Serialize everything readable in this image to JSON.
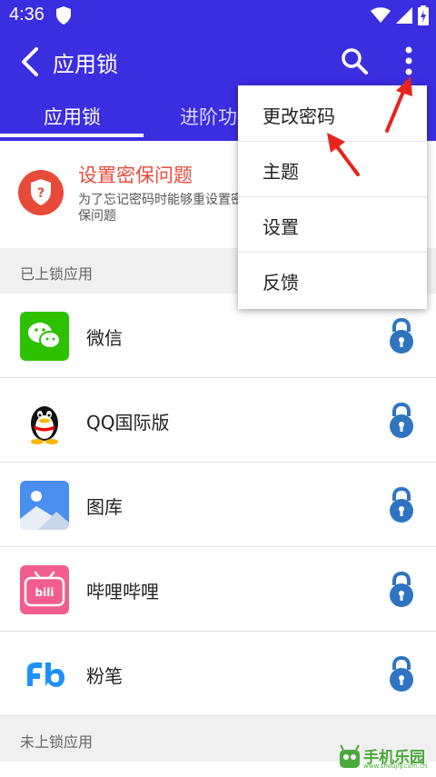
{
  "status_bar": {
    "time": "4:36"
  },
  "app_bar": {
    "title": "应用锁",
    "tabs": [
      {
        "label": "应用锁"
      },
      {
        "label": "进阶功"
      }
    ]
  },
  "promo": {
    "title": "设置密保问题",
    "description": "为了忘记密码时能够重设置密保问题"
  },
  "sections": {
    "locked": "已上锁应用",
    "unlocked": "未上锁应用"
  },
  "apps": [
    {
      "name": "微信"
    },
    {
      "name": "QQ国际版"
    },
    {
      "name": "图库"
    },
    {
      "name": "哔哩哔哩"
    },
    {
      "name": "粉笔"
    }
  ],
  "menu": {
    "items": [
      {
        "label": "更改密码"
      },
      {
        "label": "主题"
      },
      {
        "label": "设置"
      },
      {
        "label": "反馈"
      }
    ]
  },
  "watermark": {
    "text": "手机乐园",
    "sub": "www.shoujiy.com.cn"
  },
  "colors": {
    "primary": "#3b2de0",
    "accent_red": "#e84a3a",
    "lock_blue": "#2f74c0",
    "wechat_green": "#2dc100",
    "bilibili_pink": "#f25d8e"
  }
}
